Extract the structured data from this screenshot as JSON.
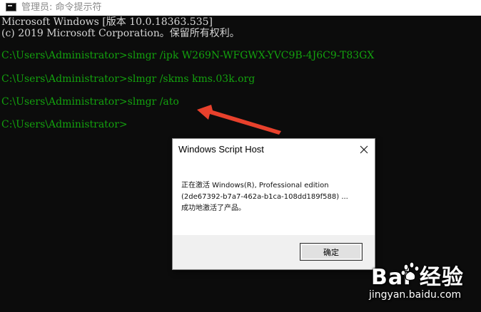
{
  "window": {
    "title": "管理员: 命令提示符",
    "icon": "cmd-icon"
  },
  "console": {
    "lines": [
      {
        "text": "Microsoft Windows [版本 10.0.18363.535]",
        "color": "#d4d4d4"
      },
      {
        "text": "(c) 2019 Microsoft Corporation。保留所有权利。",
        "color": "#d4d4d4"
      },
      {
        "text": "C:\\Users\\Administrator>slmgr /ipk W269N-WFGWX-YVC9B-4J6C9-T83GX",
        "color": "#13a10e"
      },
      {
        "text": "C:\\Users\\Administrator>slmgr /skms kms.03k.org",
        "color": "#13a10e"
      },
      {
        "text": "C:\\Users\\Administrator>slmgr /ato",
        "color": "#13a10e"
      },
      {
        "text": "C:\\Users\\Administrator>",
        "color": "#13a10e"
      }
    ]
  },
  "annotation": {
    "arrow_color": "#e8412c"
  },
  "dialog": {
    "title": "Windows Script Host",
    "close_icon": "close-icon",
    "message": "正在激活 Windows(R), Professional edition\n(2de67392-b7a7-462a-b1ca-108dd189f588) ...\n成功地激活了产品。",
    "ok_label": "确定"
  },
  "watermark": {
    "logo": "Bai  经验",
    "url": "jingyan.baidu.com"
  }
}
